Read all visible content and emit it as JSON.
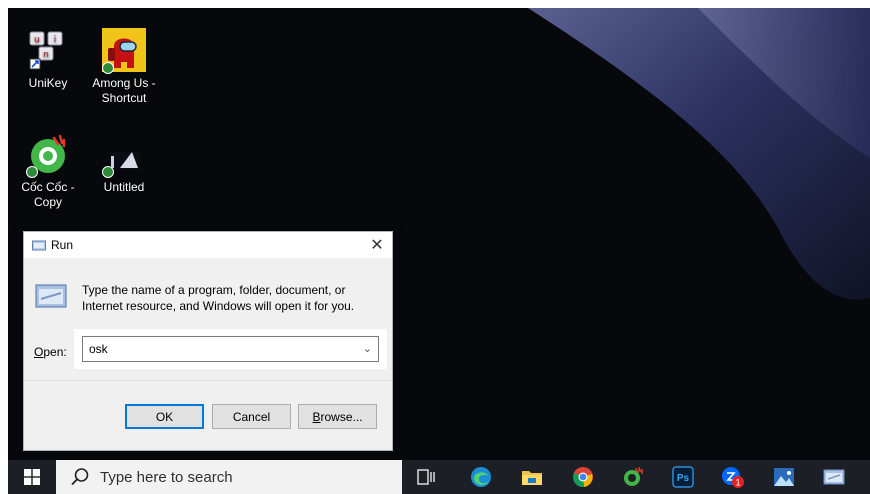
{
  "desktop": {
    "icons": [
      {
        "label": "UniKey"
      },
      {
        "label": "Among Us - Shortcut"
      },
      {
        "label": "Cốc Cốc - Copy"
      },
      {
        "label": "Untitled"
      }
    ]
  },
  "run_dialog": {
    "title": "Run",
    "close_glyph": "✕",
    "description": "Type the name of a program, folder, document, or Internet resource, and Windows will open it for you.",
    "open_label_accel": "O",
    "open_label_rest": "pen:",
    "open_value": "osk",
    "dropdown_glyph": "⌄",
    "ok_label": "OK",
    "cancel_label": "Cancel",
    "browse_label_accel": "B",
    "browse_label_rest": "rowse..."
  },
  "taskbar": {
    "search_placeholder": "Type here to search",
    "notification_count": "1",
    "ps_label": "Ps",
    "apps": [
      "task-view",
      "edge",
      "file-explorer",
      "chrome",
      "coccoc",
      "photoshop",
      "zalo",
      "photos",
      "run"
    ]
  }
}
